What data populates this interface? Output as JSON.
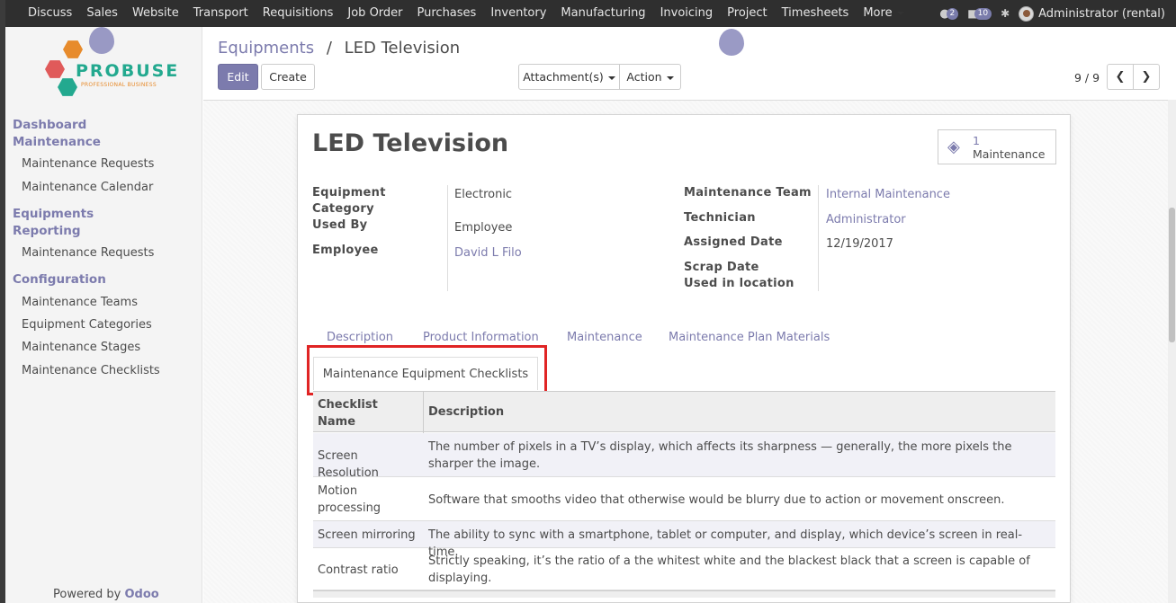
{
  "navbar": {
    "menu": [
      "Discuss",
      "Sales",
      "Website",
      "Transport",
      "Requisitions",
      "Job Order",
      "Purchases",
      "Inventory",
      "Manufacturing",
      "Invoicing",
      "Project",
      "Timesheets",
      "More"
    ],
    "chat_count": "2",
    "activity_count": "10",
    "user": "Administrator (rental)"
  },
  "sidebar": {
    "logo_brand": "PROBUSE",
    "logo_tag": "PROFESSIONAL BUSINESS",
    "sections": [
      {
        "title": "Dashboard Maintenance",
        "items": [
          "Maintenance Requests",
          "Maintenance Calendar"
        ]
      },
      {
        "title": "Equipments Reporting",
        "items": [
          "Maintenance Requests"
        ]
      },
      {
        "title": "Configuration",
        "items": [
          "Maintenance Teams",
          "Equipment Categories",
          "Maintenance Stages",
          "Maintenance Checklists"
        ]
      }
    ],
    "powered_by": "Powered by",
    "powered_brand": "Odoo"
  },
  "control_panel": {
    "breadcrumb_parent": "Equipments",
    "breadcrumb_sep": "/",
    "breadcrumb_current": "LED Television",
    "edit": "Edit",
    "create": "Create",
    "attachments": "Attachment(s)",
    "action": "Action",
    "pager": "9 / 9"
  },
  "form": {
    "title": "LED Television",
    "smart_button": {
      "count": "1",
      "label": "Maintenance"
    },
    "left_labels": {
      "category": "Equipment Category",
      "used_by": "Used By",
      "employee": "Employee"
    },
    "left_values": {
      "category": "Electronic",
      "used_by": "Employee",
      "employee": "David L Filo"
    },
    "right_labels": {
      "team": "Maintenance Team",
      "technician": "Technician",
      "assigned_date": "Assigned Date",
      "scrap_date": "Scrap Date",
      "used_in_location": "Used in location"
    },
    "right_values": {
      "team": "Internal Maintenance",
      "technician": "Administrator",
      "assigned_date": "12/19/2017"
    },
    "tabs": [
      "Description",
      "Product Information",
      "Maintenance",
      "Maintenance Plan Materials",
      "Maintenance Equipment Checklists"
    ],
    "table": {
      "headers": [
        "Checklist Name",
        "Description"
      ],
      "rows": [
        {
          "name": "Screen Resolution",
          "description": "The number of pixels in a TV’s display, which affects its sharpness — generally, the more pixels the sharper the image."
        },
        {
          "name": "Motion processing",
          "description": "Software that smooths video that otherwise would be blurry due to action or movement onscreen."
        },
        {
          "name": "Screen mirroring",
          "description": "The ability to sync with a smartphone, tablet or computer, and display, which device’s screen in real-time."
        },
        {
          "name": "Contrast ratio",
          "description": "Strictly speaking, it’s the ratio of a the whitest white and the blackest black that a screen is capable of displaying."
        }
      ]
    }
  },
  "colors": {
    "accent": "#7c7bad",
    "navbar": "#2f2f2f",
    "highlight": "#e02424",
    "logo_green": "#23a98f",
    "logo_orange": "#e78b2c"
  }
}
